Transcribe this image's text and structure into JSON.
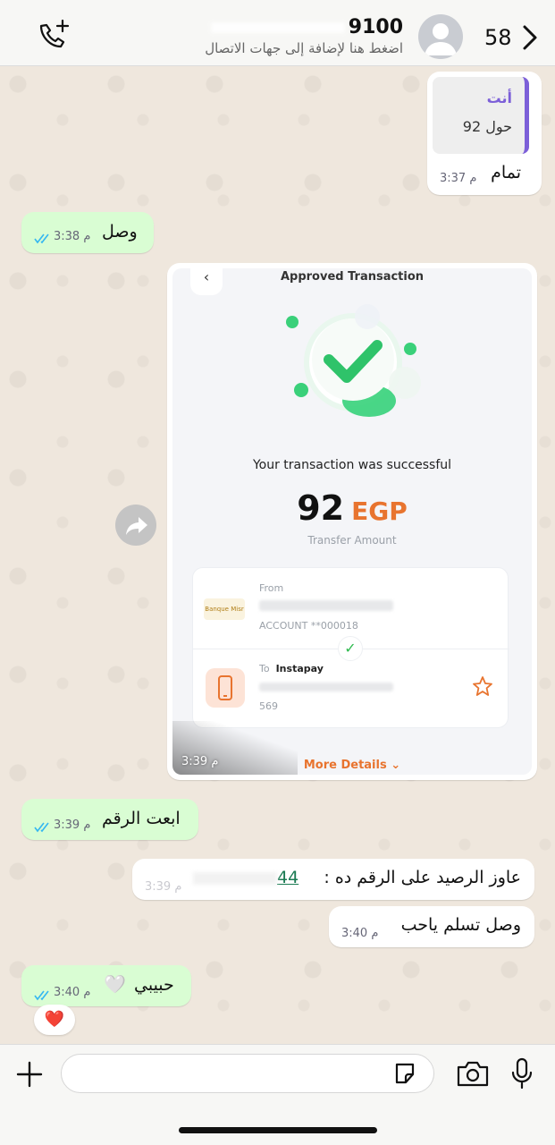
{
  "header": {
    "contact_number_visible": "9100",
    "subtitle": "اضغط هنا لإضافة إلى جهات الاتصال",
    "unread_count": "58"
  },
  "messages": {
    "m1": {
      "quote_sender": "أنت",
      "quote_text": "حول 92",
      "text": "تمام",
      "time": "3:37 م"
    },
    "m2": {
      "text": "وصل",
      "time": "3:38 م"
    },
    "m3_image": {
      "time": "3:39 م",
      "screenshot": {
        "title": "Approved Transaction",
        "success_text": "Your transaction was successful",
        "amount": "92",
        "currency": "EGP",
        "amount_label": "Transfer Amount",
        "from_label": "From",
        "bank_logo_text": "Banque Misr",
        "account_label": "ACCOUNT  **000018",
        "to_label": "To",
        "to_service": "Instapay",
        "to_account": "569",
        "more_details": "More Details"
      }
    },
    "m4": {
      "text": "ابعت الرقم",
      "time": "3:39 م"
    },
    "m5": {
      "text": "عاوز الرصيد على الرقم ده :",
      "number_tail": "44",
      "time": "3:39 م"
    },
    "m6": {
      "text": "وصل تسلم ياحب",
      "time": "3:40 م"
    },
    "m7": {
      "text": "حبيبي",
      "emoji": "🤍",
      "time": "3:40 م",
      "reaction": "❤️"
    }
  },
  "colors": {
    "outgoing_bubble": "#d9fdd3",
    "incoming_bubble": "#ffffff",
    "quote_accent": "#7c5fd8",
    "read_ticks": "#34b7f1",
    "accent_orange": "#e8742f",
    "success_green": "#2fba4f"
  }
}
